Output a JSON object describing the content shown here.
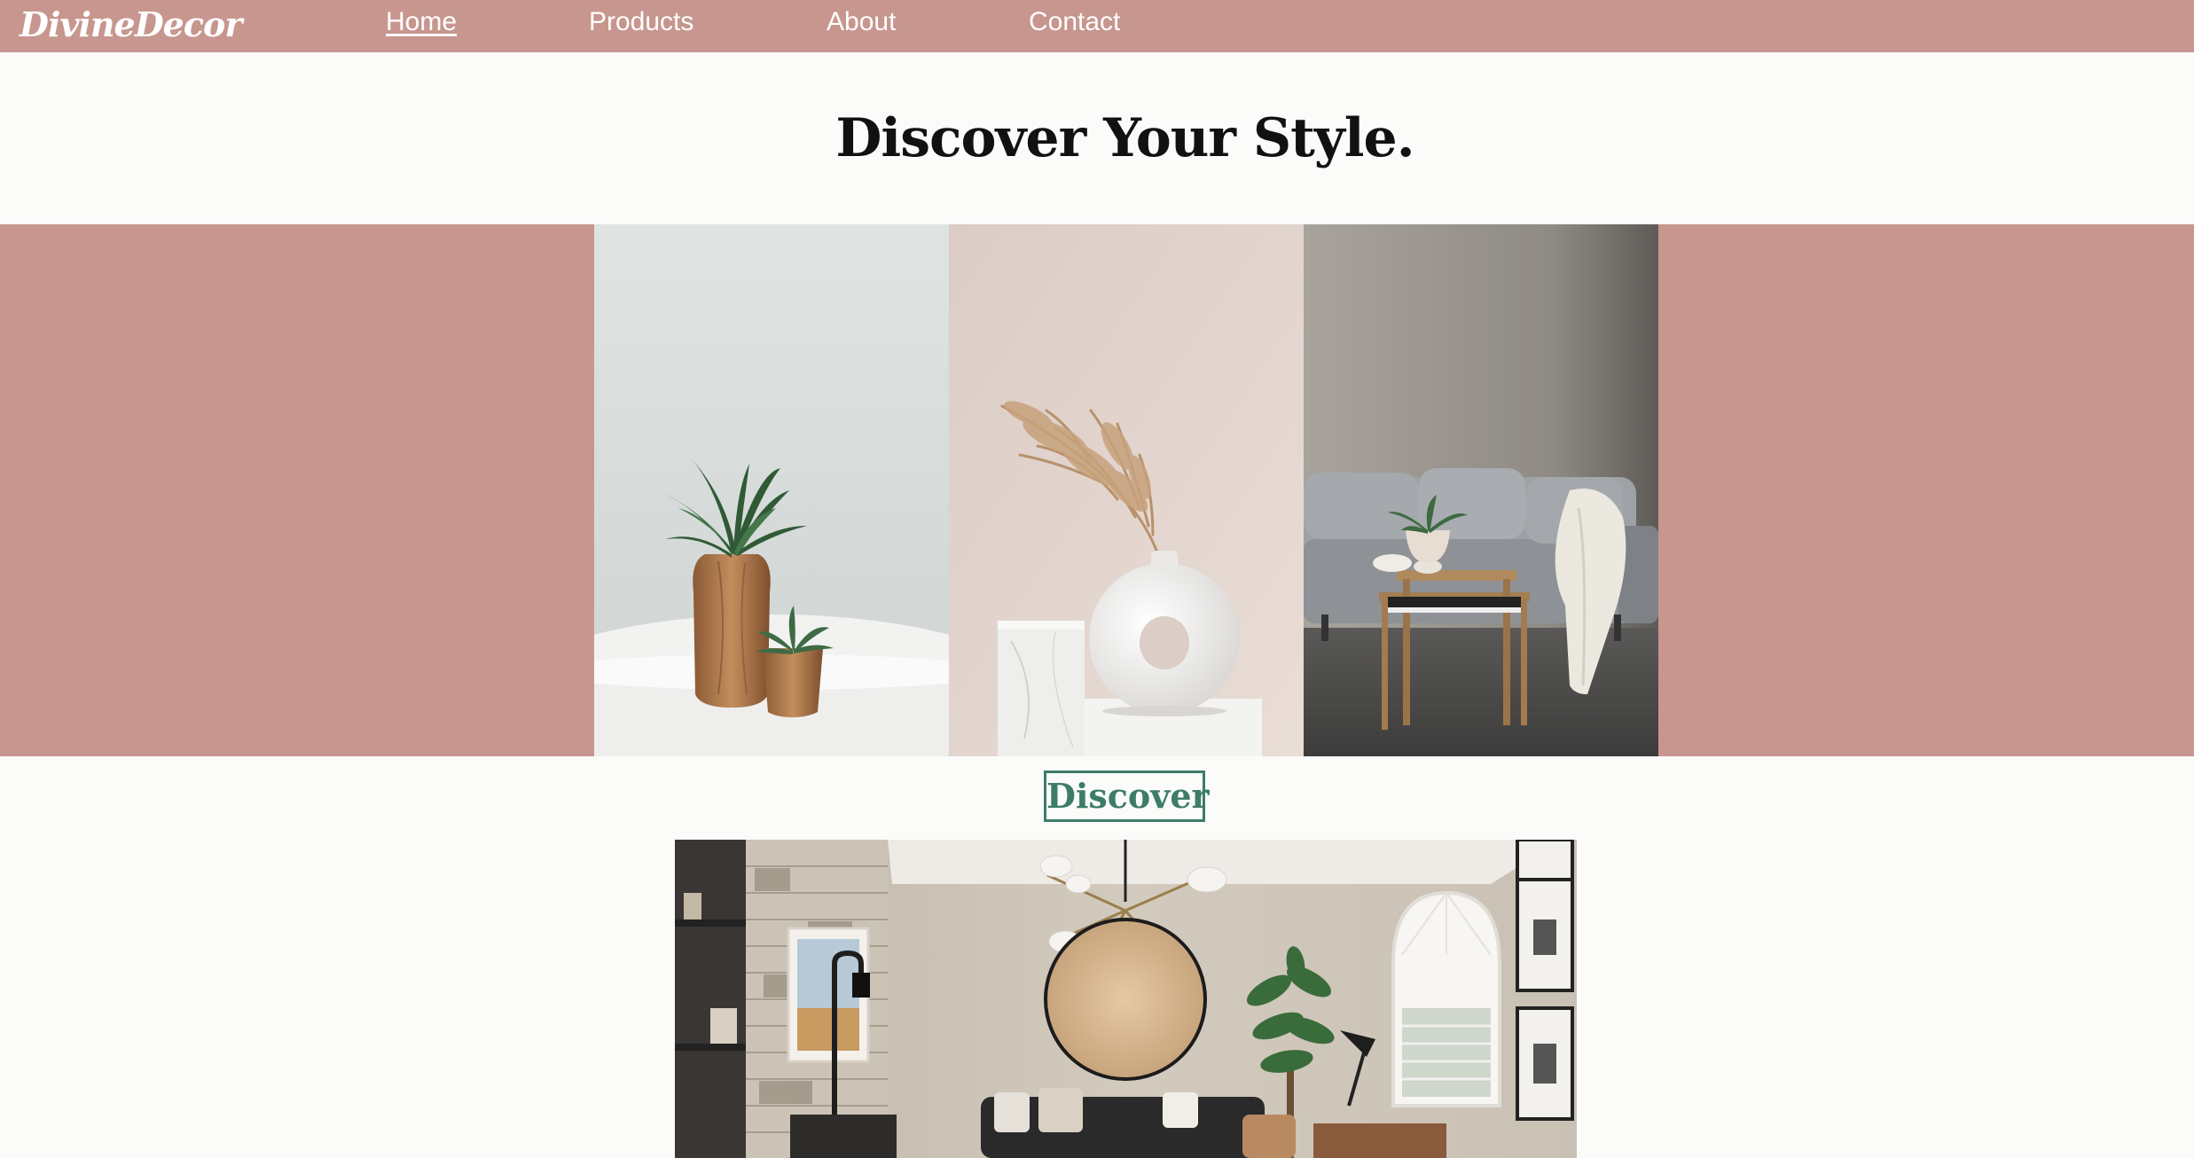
{
  "navbar": {
    "logo": "DivineDecor",
    "links": [
      {
        "label": "Home",
        "active": true
      },
      {
        "label": "Products",
        "active": false
      },
      {
        "label": "About",
        "active": false
      },
      {
        "label": "Contact",
        "active": false
      }
    ],
    "background_color": "#c7968e"
  },
  "hero": {
    "title": "Discover Your Style."
  },
  "gallery": {
    "background_color": "#c7968e",
    "images": [
      {
        "icon": "plants-in-wooden-vases-image"
      },
      {
        "icon": "donut-vase-with-pampas-image"
      },
      {
        "icon": "grey-sofa-with-side-table-image"
      }
    ]
  },
  "discover": {
    "label": "Discover",
    "color": "#3d7c66"
  },
  "feature_image": {
    "icon": "living-room-interior-image"
  }
}
